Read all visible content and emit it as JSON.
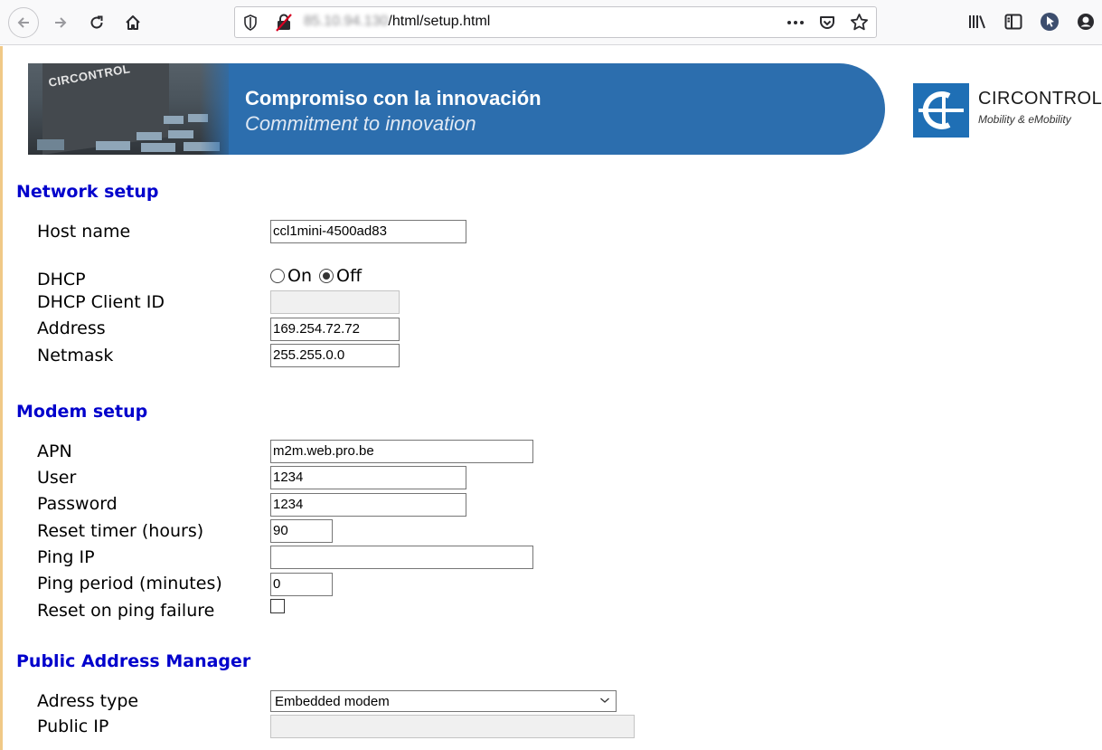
{
  "browser": {
    "url_host": "85.10.94.130",
    "url_path": "/html/setup.html"
  },
  "banner": {
    "line1": "Compromiso con la innovación",
    "line2": "Commitment to innovation",
    "building_sign": "CIRCONTROL"
  },
  "logo": {
    "name": "CIRCONTROL",
    "tagline": "Mobility & eMobility"
  },
  "network": {
    "title": "Network setup",
    "host_name_label": "Host name",
    "host_name_value": "ccl1mini-4500ad83",
    "dhcp_label": "DHCP",
    "dhcp_on_label": "On",
    "dhcp_off_label": "Off",
    "dhcp_selected": "Off",
    "dhcp_client_id_label": "DHCP Client ID",
    "dhcp_client_id_value": "",
    "address_label": "Address",
    "address_value": "169.254.72.72",
    "netmask_label": "Netmask",
    "netmask_value": "255.255.0.0"
  },
  "modem": {
    "title": "Modem setup",
    "apn_label": "APN",
    "apn_value": "m2m.web.pro.be",
    "user_label": "User",
    "user_value": "1234",
    "password_label": "Password",
    "password_value": "1234",
    "reset_timer_label": "Reset timer (hours)",
    "reset_timer_value": "90",
    "ping_ip_label": "Ping IP",
    "ping_ip_value": "",
    "ping_period_label": "Ping period (minutes)",
    "ping_period_value": "0",
    "reset_on_ping_failure_label": "Reset on ping failure",
    "reset_on_ping_failure_checked": false
  },
  "pam": {
    "title": "Public Address Manager",
    "address_type_label": "Adress type",
    "address_type_value": "Embedded modem",
    "public_ip_label": "Public IP",
    "public_ip_value": ""
  },
  "colors": {
    "section_title": "#0000cc",
    "banner_blue": "#2c6eae",
    "logo_blue": "#1f6fb5"
  }
}
